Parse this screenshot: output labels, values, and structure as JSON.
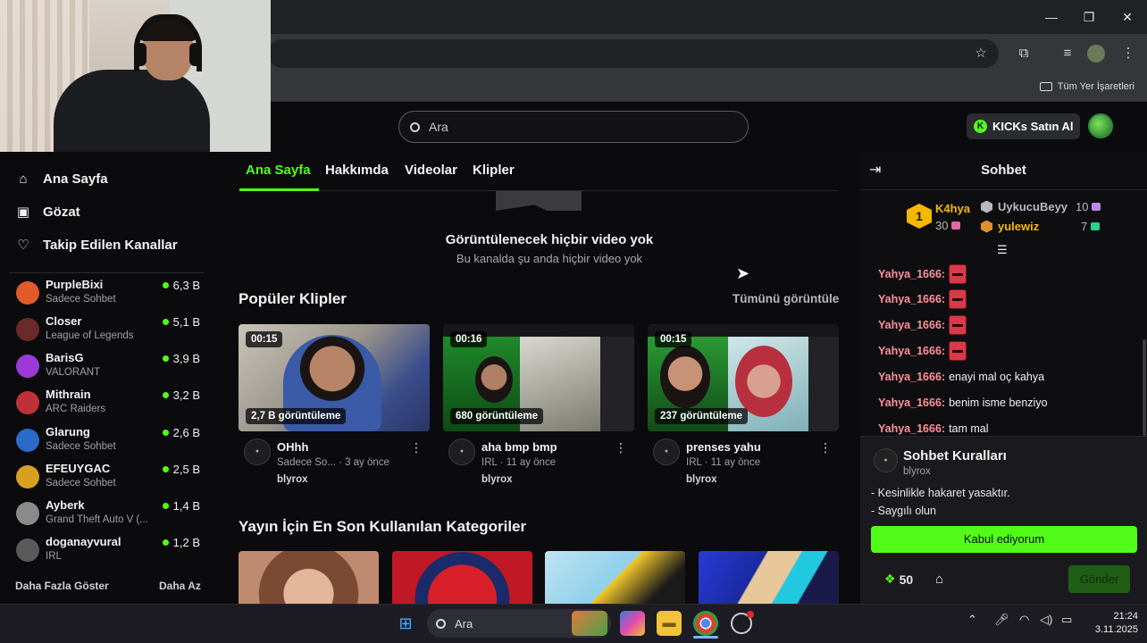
{
  "browser": {
    "bookmarks_all": "Tüm Yer İşaretleri"
  },
  "header": {
    "search_placeholder": "Ara",
    "kicks_button": "KICKs Satın Al",
    "kicks_coin": "K"
  },
  "sidebar": {
    "nav": [
      {
        "label": "Ana Sayfa",
        "icon": "home-icon"
      },
      {
        "label": "Gözat",
        "icon": "browse-icon"
      },
      {
        "label": "Takip Edilen Kanallar",
        "icon": "heart-icon"
      }
    ],
    "channels": [
      {
        "name": "PurpleBixi",
        "sub": "Sadece Sohbet",
        "viewers": "6,3 B",
        "color": "#e05a2a"
      },
      {
        "name": "Closer",
        "sub": "League of Legends",
        "viewers": "5,1 B",
        "color": "#6b2a2a"
      },
      {
        "name": "BarisG",
        "sub": "VALORANT",
        "viewers": "3,9 B",
        "color": "#9b3ad6"
      },
      {
        "name": "Mithrain",
        "sub": "ARC Raiders",
        "viewers": "3,2 B",
        "color": "#c0303a"
      },
      {
        "name": "Glarung",
        "sub": "Sadece Sohbet",
        "viewers": "2,6 B",
        "color": "#2a6ac8"
      },
      {
        "name": "EFEUYGAC",
        "sub": "Sadece Sohbet",
        "viewers": "2,5 B",
        "color": "#d8a020"
      },
      {
        "name": "Ayberk",
        "sub": "Grand Theft Auto V (...",
        "viewers": "1,4 B",
        "color": "#8a8a8a"
      },
      {
        "name": "doganayvural",
        "sub": "IRL",
        "viewers": "1,2 B",
        "color": "#5a5a5a"
      }
    ],
    "show_more": "Daha Fazla Göster",
    "show_less": "Daha Az"
  },
  "main": {
    "tabs": [
      "Ana Sayfa",
      "Hakkımda",
      "Videolar",
      "Klipler"
    ],
    "empty_title": "Görüntülenecek hiçbir video yok",
    "empty_sub": "Bu kanalda şu anda hiçbir video yok",
    "popular_clips_title": "Popüler Klipler",
    "see_all": "Tümünü görüntüle",
    "clips": [
      {
        "duration": "00:15",
        "views": "2,7 B görüntüleme",
        "title": "OHhh",
        "meta": "Sadece So... · 3 ay önce",
        "author": "blyrox"
      },
      {
        "duration": "00:16",
        "views": "680 görüntüleme",
        "title": "aha bmp bmp",
        "meta": "IRL · 11 ay önce",
        "author": "blyrox"
      },
      {
        "duration": "00:15",
        "views": "237 görüntüleme",
        "title": "prenses yahu",
        "meta": "IRL · 11 ay önce",
        "author": "blyrox"
      }
    ],
    "categories_title": "Yayın İçin En Son Kullanılan Kategoriler"
  },
  "chat": {
    "title": "Sohbet",
    "leaderboard": {
      "rank": "1",
      "first": {
        "name": "K4hya",
        "count": "30"
      },
      "second": {
        "name": "UykucuBeyy",
        "count": "10"
      },
      "third": {
        "name": "yulewiz",
        "count": "7"
      }
    },
    "messages": [
      {
        "user": "Yahya_1666:",
        "text": ""
      },
      {
        "user": "Yahya_1666:",
        "text": ""
      },
      {
        "user": "Yahya_1666:",
        "text": ""
      },
      {
        "user": "Yahya_1666:",
        "text": ""
      },
      {
        "user": "Yahya_1666:",
        "text": "enayi mal oç kahya"
      },
      {
        "user": "Yahya_1666:",
        "text": "benim isme benziyo"
      },
      {
        "user": "Yahya_1666:",
        "text": "tam mal"
      }
    ],
    "rules": {
      "title": "Sohbet Kuralları",
      "owner": "blyrox",
      "lines": [
        "- Kesinlikle hakaret yasaktır.",
        "- Saygılı olun"
      ],
      "accept": "Kabul ediyorum"
    },
    "points": "50",
    "send": "Gönder"
  },
  "taskbar": {
    "search": "Ara",
    "time": "21:24",
    "date": "3.11.2025"
  }
}
